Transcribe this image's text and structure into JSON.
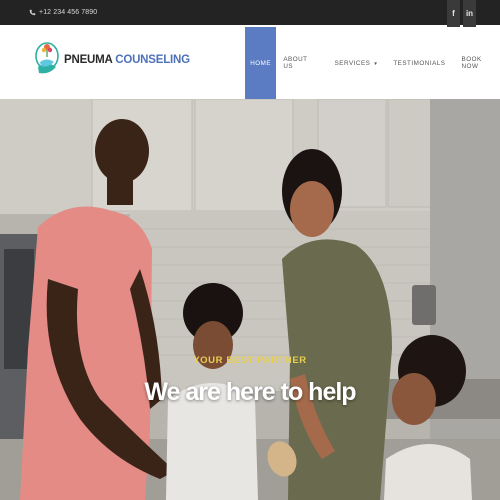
{
  "topbar": {
    "phone": "+12 234 456 7890",
    "social": [
      {
        "icon": "facebook-icon",
        "label": "f"
      },
      {
        "icon": "linkedin-icon",
        "label": "in"
      }
    ]
  },
  "brand": {
    "name_part1": "PNEUMA",
    "name_part2": "COUNSELING"
  },
  "nav": {
    "items": [
      {
        "label": "HOME",
        "active": true
      },
      {
        "label": "ABOUT US",
        "active": false
      },
      {
        "label": "SERVICES",
        "active": false,
        "dropdown": true
      },
      {
        "label": "TESTIMONIALS",
        "active": false
      },
      {
        "label": "BOOK NOW",
        "active": false
      }
    ]
  },
  "hero": {
    "tagline": "YOUR BEST PARTNER",
    "headline": "We are here to help"
  },
  "colors": {
    "topbar": "#232323",
    "accent": "#5b7bc2",
    "brand_blue": "#4e72b8",
    "tagline": "#e7cf52"
  }
}
